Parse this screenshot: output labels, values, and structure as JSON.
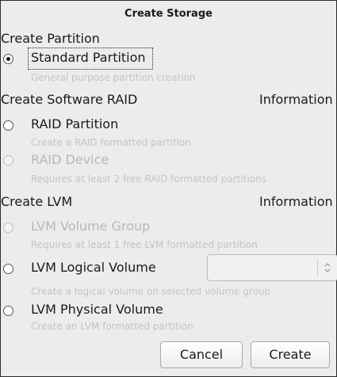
{
  "dialog": {
    "title": "Create Storage"
  },
  "sections": {
    "partition": {
      "label": "Create Partition"
    },
    "raid": {
      "label": "Create Software RAID",
      "info_label": "Information"
    },
    "lvm": {
      "label": "Create LVM",
      "info_label": "Information"
    }
  },
  "options": {
    "standard_partition": {
      "label": "Standard Partition",
      "hint": "General purpose partition creation",
      "selected": true,
      "enabled": true
    },
    "raid_partition": {
      "label": "RAID Partition",
      "hint": "Create a RAID formatted partition",
      "selected": false,
      "enabled": true
    },
    "raid_device": {
      "label": "RAID Device",
      "hint": "Requires at least 2 free RAID formatted partitions",
      "selected": false,
      "enabled": false
    },
    "lvm_volume_group": {
      "label": "LVM Volume Group",
      "hint": "Requires at least 1 free LVM formatted partition",
      "selected": false,
      "enabled": false
    },
    "lvm_logical_volume": {
      "label": "LVM Logical Volume",
      "hint": "Create a logical volume on selected volume group",
      "selected": false,
      "enabled": true
    },
    "lvm_physical_volume": {
      "label": "LVM Physical Volume",
      "hint": "Create an LVM formatted partition",
      "selected": false,
      "enabled": true
    }
  },
  "volume_group_combo": {
    "value": "",
    "enabled": false
  },
  "buttons": {
    "cancel": "Cancel",
    "create": "Create"
  },
  "icons": {
    "combo_arrow": "updown-chevron-icon"
  }
}
